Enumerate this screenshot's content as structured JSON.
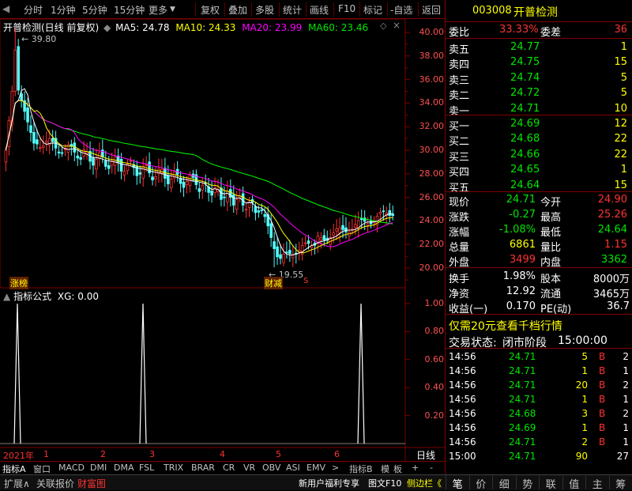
{
  "toolbar": {
    "left": [
      "分时",
      "1分钟",
      "5分钟",
      "15分钟",
      "更多"
    ],
    "right": [
      "复权",
      "叠加",
      "多股",
      "统计",
      "画线",
      "F10",
      "标记",
      "-自选",
      "返回"
    ]
  },
  "kline": {
    "title": "开普检测(日线 前复权)",
    "ma5": "MA5: 24.78",
    "ma10": "MA10: 24.33",
    "ma20": "MA20: 23.99",
    "ma60": "MA60: 23.46",
    "high_label": "39.80",
    "low_label": "19.55",
    "tag_left": "涨榜",
    "tag_mid": "财减",
    "tag_s": "S",
    "y_ticks": [
      "40.00",
      "38.00",
      "36.00",
      "34.00",
      "32.00",
      "30.00",
      "28.00",
      "26.00",
      "24.00",
      "22.00",
      "20.00"
    ]
  },
  "indicator": {
    "title": "指标公式",
    "value": "XG: 0.00",
    "y_ticks": [
      "1.00",
      "0.80",
      "0.60",
      "0.40",
      "0.20"
    ]
  },
  "x_axis": {
    "labels": [
      "2021年",
      "1",
      "2",
      "3",
      "4",
      "5",
      "6"
    ],
    "period": "日线"
  },
  "bottom_tabs": [
    "指标A",
    "窗口",
    "MACD",
    "DMI",
    "DMA",
    "FSL",
    "TRIX",
    "BRAR",
    "CR",
    "VR",
    "OBV",
    "ASI",
    "EMV",
    ">",
    "指标B",
    "模",
    "板",
    "+",
    "-"
  ],
  "status_bar": {
    "expand": "扩展∧",
    "related": "关联报价",
    "caifu": "财富图",
    "promo1": "新用户福利专享",
    "promo2": "图文F10",
    "promo3": "侧边栏《"
  },
  "quote": {
    "code": "003008",
    "name": "开普检测",
    "weibi_label": "委比",
    "weibi": "33.33%",
    "weicha_label": "委差",
    "weicha": "36",
    "asks": [
      {
        "label": "卖五",
        "price": "24.77",
        "vol": "1"
      },
      {
        "label": "卖四",
        "price": "24.75",
        "vol": "15"
      },
      {
        "label": "卖三",
        "price": "24.74",
        "vol": "5"
      },
      {
        "label": "卖二",
        "price": "24.72",
        "vol": "5"
      },
      {
        "label": "卖一",
        "price": "24.71",
        "vol": "10"
      }
    ],
    "bids": [
      {
        "label": "买一",
        "price": "24.69",
        "vol": "12"
      },
      {
        "label": "买二",
        "price": "24.68",
        "vol": "22"
      },
      {
        "label": "买三",
        "price": "24.66",
        "vol": "22"
      },
      {
        "label": "买四",
        "price": "24.65",
        "vol": "1"
      },
      {
        "label": "买五",
        "price": "24.64",
        "vol": "15"
      }
    ],
    "stats": [
      {
        "l1": "现价",
        "v1": "24.71",
        "c1": "green",
        "l2": "今开",
        "v2": "24.90",
        "c2": "red"
      },
      {
        "l1": "涨跌",
        "v1": "-0.27",
        "c1": "green",
        "l2": "最高",
        "v2": "25.26",
        "c2": "red"
      },
      {
        "l1": "涨幅",
        "v1": "-1.08%",
        "c1": "green",
        "l2": "最低",
        "v2": "24.64",
        "c2": "green"
      },
      {
        "l1": "总量",
        "v1": "6861",
        "c1": "yellow",
        "l2": "量比",
        "v2": "1.15",
        "c2": "red"
      },
      {
        "l1": "外盘",
        "v1": "3499",
        "c1": "red",
        "l2": "内盘",
        "v2": "3362",
        "c2": "green"
      }
    ],
    "fund": [
      {
        "l1": "换手",
        "v1": "1.98%",
        "l2": "股本",
        "v2": "8000万"
      },
      {
        "l1": "净资",
        "v1": "12.92",
        "l2": "流通",
        "v2": "3465万"
      },
      {
        "l1": "收益(一)",
        "v1": "0.170",
        "l2": "PE(动)",
        "v2": "36.7"
      }
    ],
    "promo": "仅需20元查看千档行情",
    "trade_status_label": "交易状态:",
    "trade_status": "闭市阶段",
    "trade_time": "15:00:00",
    "ticks": [
      {
        "t": "14:56",
        "p": "24.71",
        "v": "5",
        "d": "B",
        "n": "2"
      },
      {
        "t": "14:56",
        "p": "24.71",
        "v": "1",
        "d": "B",
        "n": "1"
      },
      {
        "t": "14:56",
        "p": "24.71",
        "v": "20",
        "d": "B",
        "n": "2"
      },
      {
        "t": "14:56",
        "p": "24.71",
        "v": "1",
        "d": "B",
        "n": "1"
      },
      {
        "t": "14:56",
        "p": "24.68",
        "v": "3",
        "d": "B",
        "n": "2"
      },
      {
        "t": "14:56",
        "p": "24.69",
        "v": "1",
        "d": "B",
        "n": "1"
      },
      {
        "t": "14:56",
        "p": "24.71",
        "v": "2",
        "d": "B",
        "n": "1"
      },
      {
        "t": "15:00",
        "p": "24.71",
        "v": "90",
        "d": "",
        "n": "27"
      }
    ],
    "nav": [
      "笔",
      "价",
      "细",
      "势",
      "联",
      "值",
      "主",
      "筹"
    ]
  },
  "colors": {
    "up": "#ff3232",
    "down": "#00e600",
    "ma5": "#ffffff",
    "ma10": "#ffff00",
    "ma20": "#ff00ff",
    "ma60": "#00ff00",
    "grid": "#800000"
  }
}
